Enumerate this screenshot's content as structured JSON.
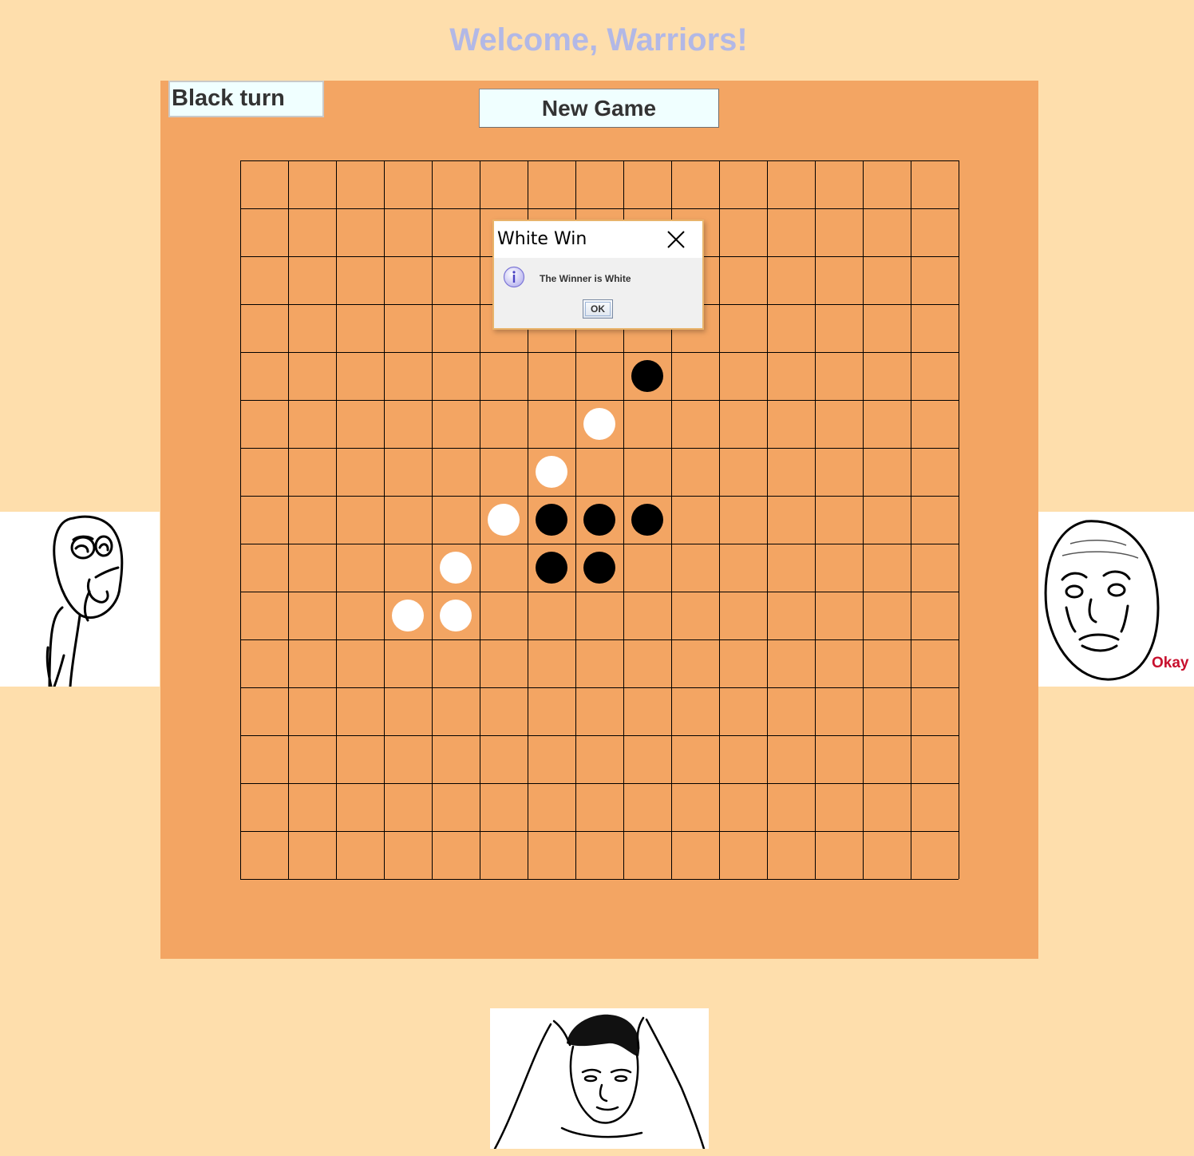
{
  "app": {
    "heading": "Welcome, Warriors!"
  },
  "controls": {
    "turn_status": "Black turn",
    "new_game_label": "New Game"
  },
  "board": {
    "size": 15,
    "stones": [
      {
        "row": 4,
        "col": 8,
        "color": "black"
      },
      {
        "row": 5,
        "col": 7,
        "color": "white"
      },
      {
        "row": 6,
        "col": 6,
        "color": "white"
      },
      {
        "row": 7,
        "col": 5,
        "color": "white"
      },
      {
        "row": 7,
        "col": 6,
        "color": "black"
      },
      {
        "row": 7,
        "col": 7,
        "color": "black"
      },
      {
        "row": 7,
        "col": 8,
        "color": "black"
      },
      {
        "row": 8,
        "col": 4,
        "color": "white"
      },
      {
        "row": 8,
        "col": 6,
        "color": "black"
      },
      {
        "row": 8,
        "col": 7,
        "color": "black"
      },
      {
        "row": 9,
        "col": 3,
        "color": "white"
      },
      {
        "row": 9,
        "col": 4,
        "color": "white"
      }
    ]
  },
  "dialog": {
    "title": "White Win",
    "message": "The Winner is White",
    "ok_label": "OK"
  },
  "images": {
    "right_caption": "Okay"
  },
  "colors": {
    "background": "#fedeac",
    "board": "#f3a563",
    "heading": "#b2b8e6",
    "field_bg": "#f0ffff",
    "dialog_border": "#e9b46b"
  }
}
